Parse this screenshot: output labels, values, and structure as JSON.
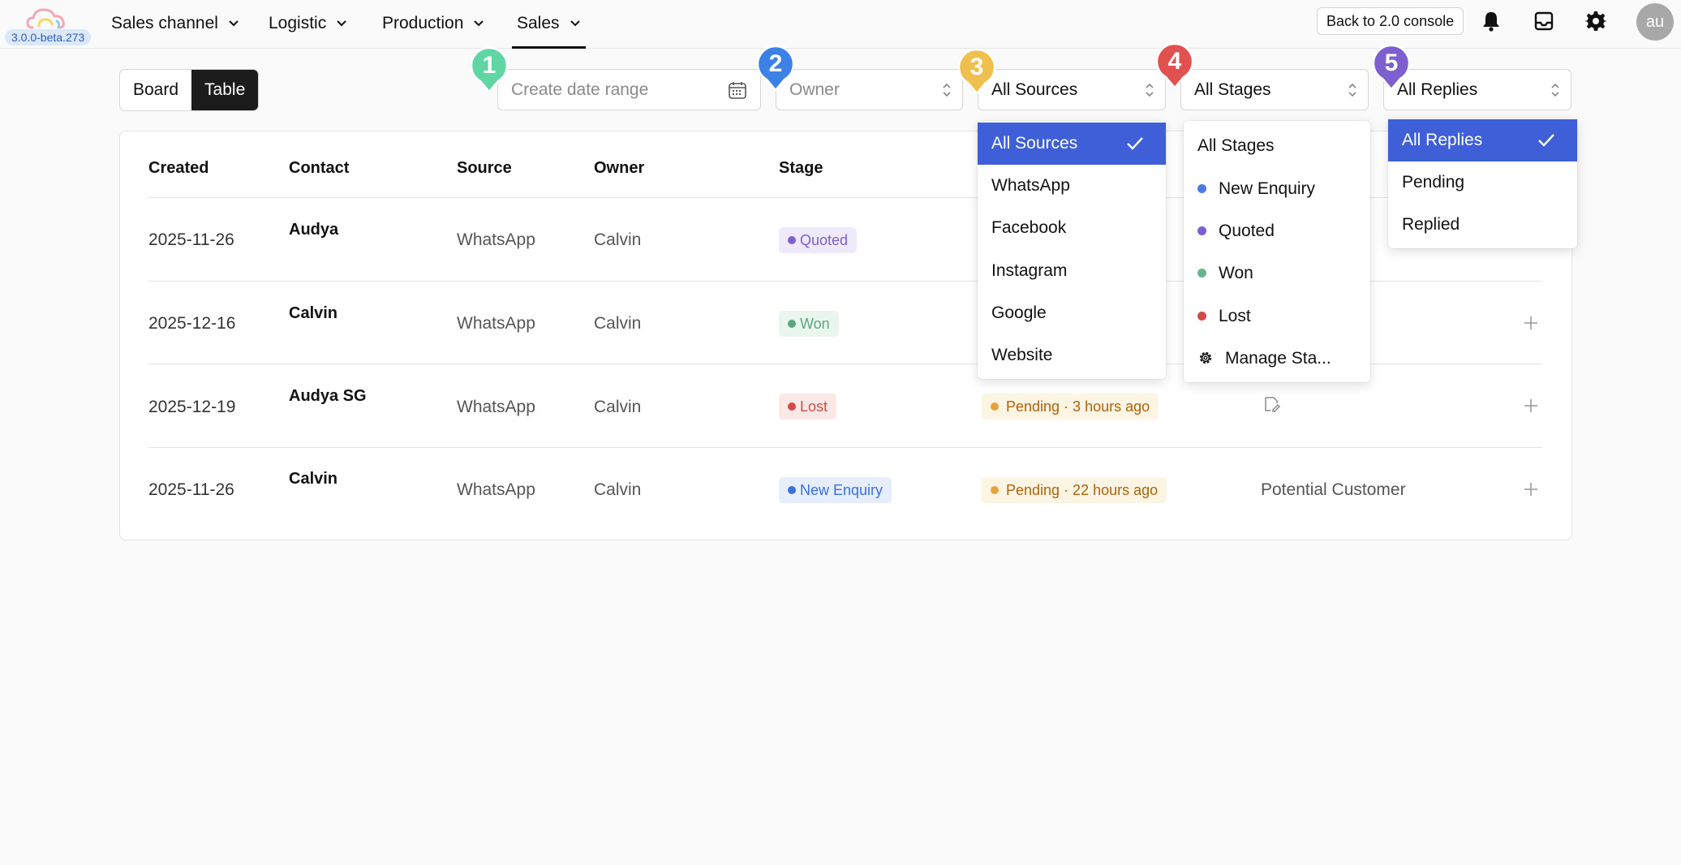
{
  "app": {
    "version": "3.0.0-beta.273",
    "back_label": "Back to 2.0 console",
    "avatar_initials": "au"
  },
  "nav": {
    "items": [
      {
        "label": "Sales channel"
      },
      {
        "label": "Logistic"
      },
      {
        "label": "Production"
      },
      {
        "label": "Sales",
        "active": true
      }
    ]
  },
  "view_toggle": {
    "board": "Board",
    "table": "Table",
    "selected": "Table"
  },
  "filters": {
    "date_placeholder": "Create date range",
    "owner_placeholder": "Owner",
    "source_value": "All Sources",
    "stage_value": "All Stages",
    "reply_value": "All Replies"
  },
  "markers": [
    {
      "number": "1",
      "color": "#5fd6a4"
    },
    {
      "number": "2",
      "color": "#3c82e6"
    },
    {
      "number": "3",
      "color": "#f0c04e"
    },
    {
      "number": "4",
      "color": "#e0514f"
    },
    {
      "number": "5",
      "color": "#7d5fcf"
    }
  ],
  "table": {
    "columns": [
      "Created",
      "Contact",
      "Source",
      "Owner",
      "Stage"
    ],
    "rows": [
      {
        "created": "2025-11-26",
        "contact": "Audya",
        "source": "WhatsApp",
        "owner": "Calvin",
        "stage": "Quoted",
        "reply": "",
        "note": ""
      },
      {
        "created": "2025-12-16",
        "contact": "Calvin",
        "source": "WhatsApp",
        "owner": "Calvin",
        "stage": "Won",
        "reply": "",
        "note": ""
      },
      {
        "created": "2025-12-19",
        "contact": "Audya SG",
        "source": "WhatsApp",
        "owner": "Calvin",
        "stage": "Lost",
        "reply": "Pending · 3 hours ago",
        "note": ""
      },
      {
        "created": "2025-11-26",
        "contact": "Calvin",
        "source": "WhatsApp",
        "owner": "Calvin",
        "stage": "New Enquiry",
        "reply": "Pending · 22 hours ago",
        "note": "Potential Customer"
      }
    ]
  },
  "stage_colors": {
    "Quoted": {
      "fg": "#7d5fcf",
      "bg": "#efeafb"
    },
    "Won": {
      "fg": "#5aa77a",
      "bg": "#e9f5ed"
    },
    "Lost": {
      "fg": "#d14a48",
      "bg": "#fbe7e6"
    },
    "New Enquiry": {
      "fg": "#3c6fe0",
      "bg": "#e6eefc"
    }
  },
  "source_dropdown": {
    "options": [
      "All Sources",
      "WhatsApp",
      "Facebook",
      "Instagram",
      "Google",
      "Website"
    ],
    "selected": "All Sources"
  },
  "stage_dropdown": {
    "options": [
      {
        "label": "All Stages",
        "color": ""
      },
      {
        "label": "New Enquiry",
        "color": "#4f79e6"
      },
      {
        "label": "Quoted",
        "color": "#7d5fcf"
      },
      {
        "label": "Won",
        "color": "#6bb38a"
      },
      {
        "label": "Lost",
        "color": "#d14a48"
      }
    ],
    "manage_label": "Manage Sta..."
  },
  "reply_dropdown": {
    "options": [
      "All Replies",
      "Pending",
      "Replied"
    ],
    "selected": "All Replies"
  }
}
